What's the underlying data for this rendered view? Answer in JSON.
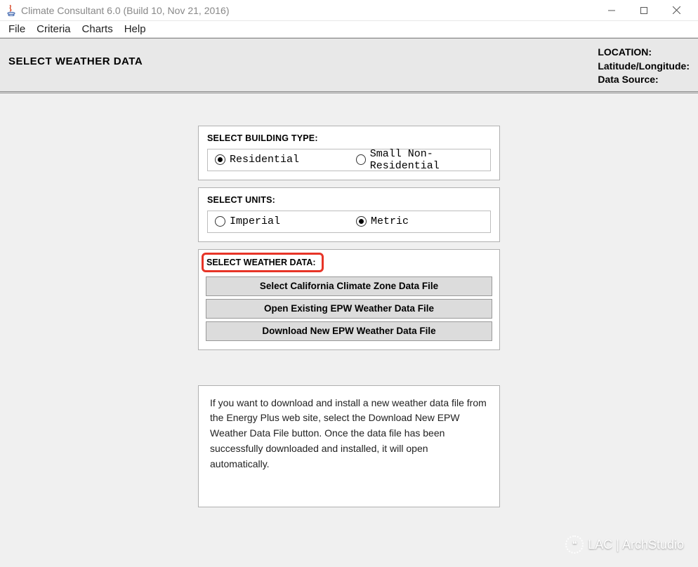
{
  "window": {
    "title": "Climate Consultant 6.0 (Build 10, Nov 21, 2016)"
  },
  "menubar": {
    "items": [
      "File",
      "Criteria",
      "Charts",
      "Help"
    ]
  },
  "header": {
    "page_title": "SELECT WEATHER DATA",
    "location_label": "LOCATION:",
    "latlon_label": "Latitude/Longitude:",
    "datasource_label": "Data Source:"
  },
  "building_type": {
    "label": "SELECT BUILDING TYPE:",
    "options": [
      {
        "label": "Residential",
        "checked": true
      },
      {
        "label": "Small Non-Residential",
        "checked": false
      }
    ]
  },
  "units": {
    "label": "SELECT UNITS:",
    "options": [
      {
        "label": "Imperial",
        "checked": false
      },
      {
        "label": "Metric",
        "checked": true
      }
    ]
  },
  "weather_data": {
    "label": "SELECT WEATHER DATA:",
    "buttons": [
      "Select California Climate Zone Data File",
      "Open Existing EPW Weather Data File",
      "Download New EPW Weather Data File"
    ]
  },
  "info": {
    "text": "If you want to download and install a new weather data file from the Energy Plus web site, select the Download New EPW Weather Data File button.  Once the data file has been successfully downloaded and installed, it will open automatically."
  },
  "watermark": {
    "text": "LAC | ArchStudio"
  }
}
